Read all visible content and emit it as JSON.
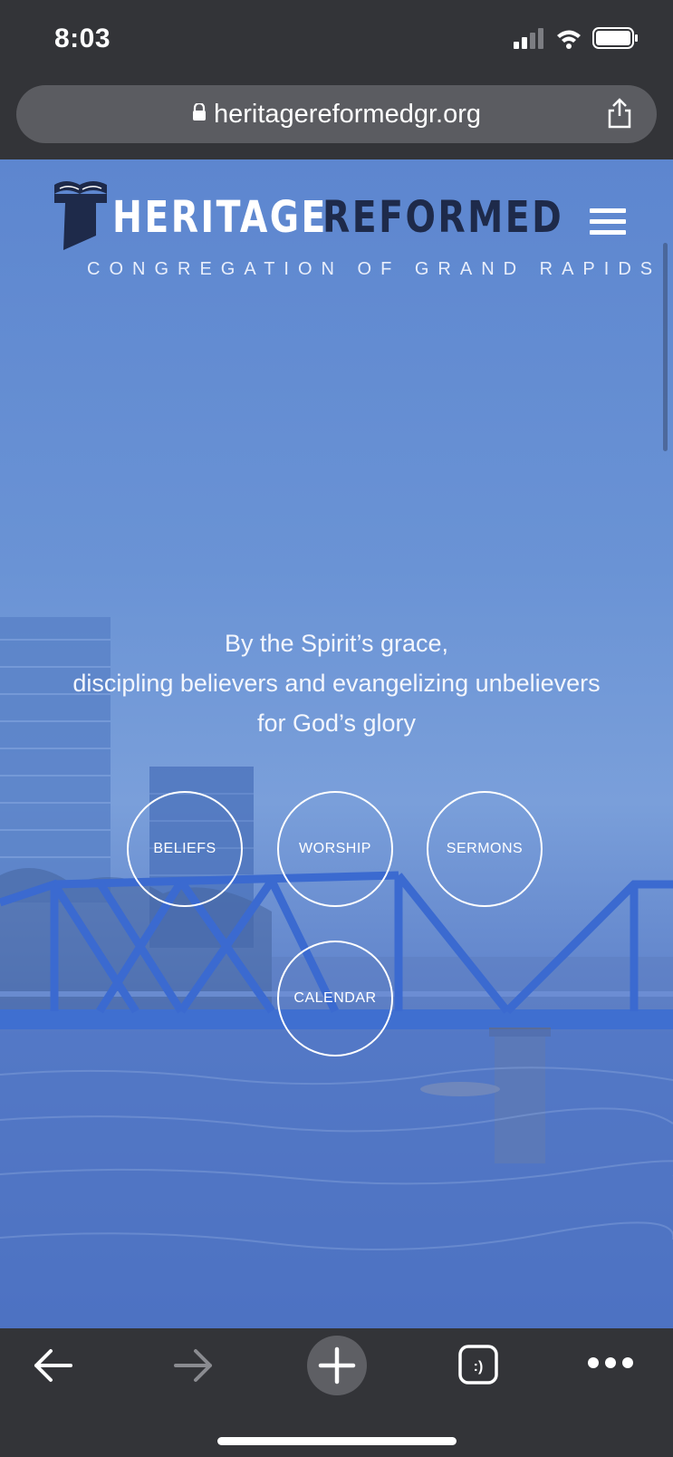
{
  "status_bar": {
    "time": "8:03"
  },
  "browser": {
    "url": "heritagereformedgr.org"
  },
  "site": {
    "logo": {
      "word1": "HERITAGE",
      "word2": "REFORMED",
      "subtitle": "CONGREGATION OF GRAND RAPIDS"
    },
    "tagline": {
      "line1": "By the Spirit’s grace,",
      "line2": "discipling believers and evangelizing unbelievers",
      "line3": "for God’s glory"
    },
    "nav_circles": {
      "beliefs": "BELIEFS",
      "worship": "WORSHIP",
      "sermons": "SERMONS",
      "calendar": "CALENDAR"
    }
  },
  "icons": {
    "lock": "lock-icon",
    "share": "share-icon",
    "menu": "hamburger-menu-icon",
    "back": "back-arrow-icon",
    "forward": "forward-arrow-icon",
    "new_tab": "plus-icon",
    "tabs": "tabs-icon",
    "more": "more-dots-icon"
  },
  "colors": {
    "hero_blue": "#6a93d5",
    "logo_dark": "#1e2a4a",
    "chrome_bg": "#333438"
  }
}
